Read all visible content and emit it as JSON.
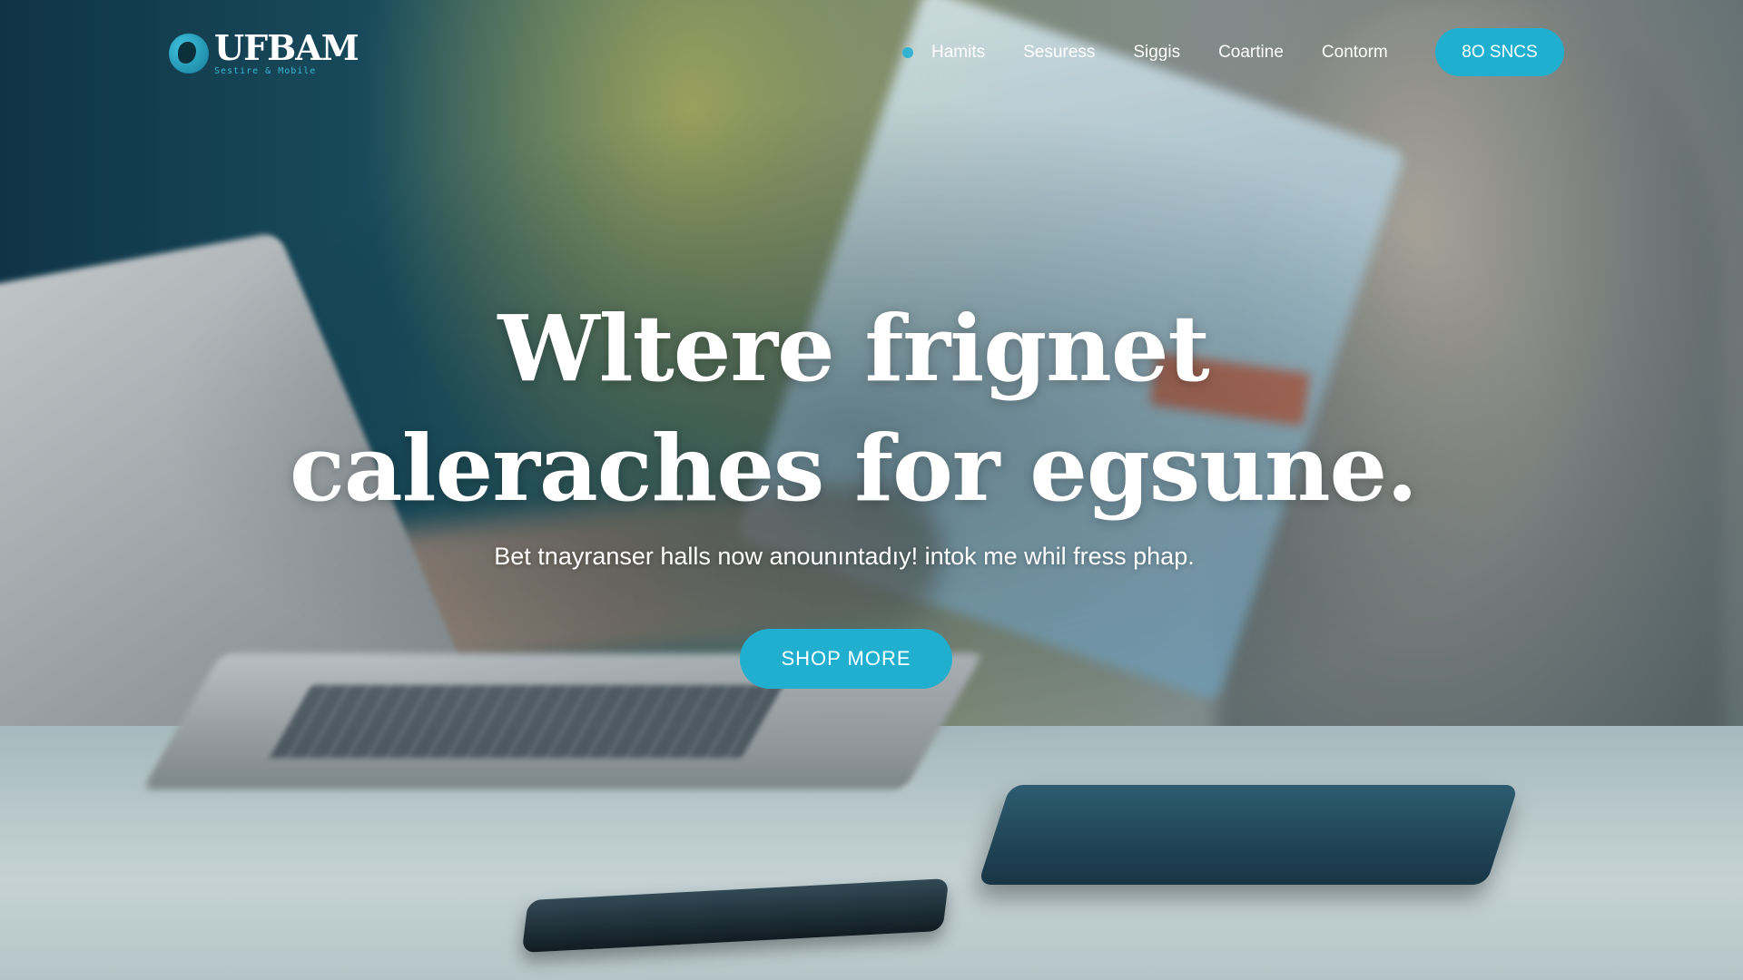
{
  "brand": {
    "name": "UFBAM",
    "tagline": "Sestire & Mobile",
    "accent_color": "#21afd0"
  },
  "nav": {
    "items": [
      {
        "label": "Hamits"
      },
      {
        "label": "Sesuress"
      },
      {
        "label": "Siggis"
      },
      {
        "label": "Coartine"
      },
      {
        "label": "Contorm"
      }
    ],
    "cta_label": "8O SNCS"
  },
  "hero": {
    "title_line1": "Wltere frignet",
    "title_line2": "caleraches for egsune.",
    "subtitle": "Bet tnayranser halls now anounıntadıy! intok me whil fress phap.",
    "cta_label": "SHOP MORE"
  }
}
